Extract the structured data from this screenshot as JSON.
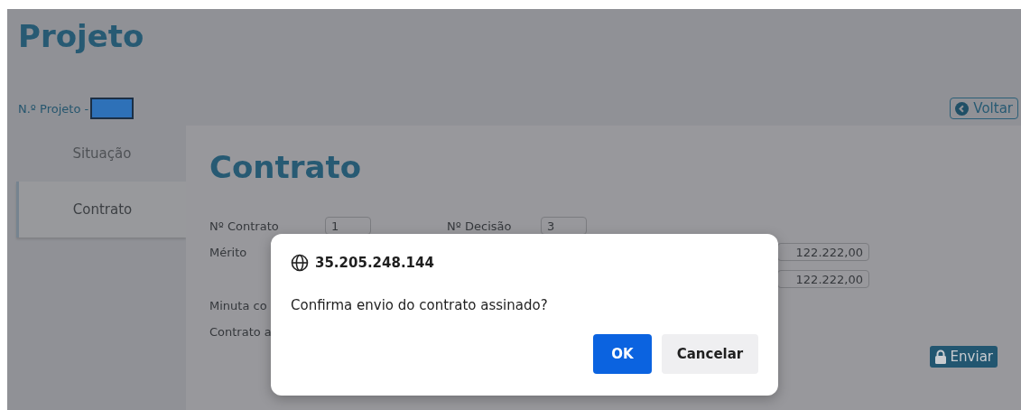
{
  "header": {
    "title": "Projeto",
    "project_label": "N.º Projeto -",
    "back_button": "Voltar"
  },
  "tabs": [
    {
      "label": "Situação",
      "selected": false
    },
    {
      "label": "Contrato",
      "selected": true
    }
  ],
  "content": {
    "title": "Contrato",
    "contract_no": {
      "label": "Nº Contrato",
      "value": "1"
    },
    "decision_no": {
      "label": "Nº Decisão",
      "value": "3"
    },
    "merit_label": "Mérito",
    "amounts": [
      "122.222,00",
      "122.222,00"
    ],
    "draft_label": "Minuta co",
    "signed_label": "Contrato a",
    "send_button": "Enviar"
  },
  "dialog": {
    "origin": "35.205.248.144",
    "message": "Confirma envio do contrato assinado?",
    "buttons": [
      {
        "label": "OK",
        "kind": "primary"
      },
      {
        "label": "Cancelar",
        "kind": "secondary"
      }
    ]
  }
}
